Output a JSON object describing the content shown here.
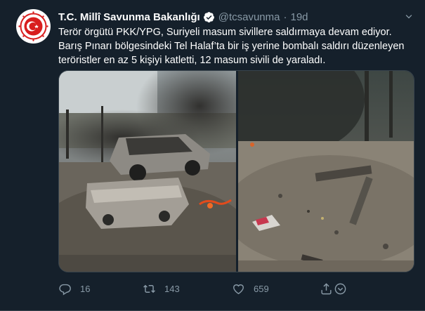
{
  "tweet": {
    "author_name": "T.C. Millî Savunma Bakanlığı",
    "handle": "@tcsavunma",
    "separator": "·",
    "time": "19d",
    "text": "Terör örgütü PKK/YPG, Suriyeli masum sivillere saldırmaya devam ediyor. Barış Pınarı bölgesindeki Tel Halaf’ta bir iş yerine bombalı saldırı düzenleyen teröristler en az 5 kişiyi katletti, 12 masum sivili de yaraladı."
  },
  "actions": {
    "reply_count": "16",
    "retweet_count": "143",
    "like_count": "659"
  },
  "icons": {
    "verified": "verified-badge-icon",
    "caret": "chevron-down-icon",
    "reply": "reply-icon",
    "retweet": "retweet-icon",
    "like": "heart-icon",
    "share": "share-icon",
    "bookmark": "bookmark-icon"
  },
  "colors": {
    "background": "#15202b",
    "secondary_text": "#8899a6",
    "accent": "#1da1f2",
    "logo_red": "#d81e1e"
  }
}
